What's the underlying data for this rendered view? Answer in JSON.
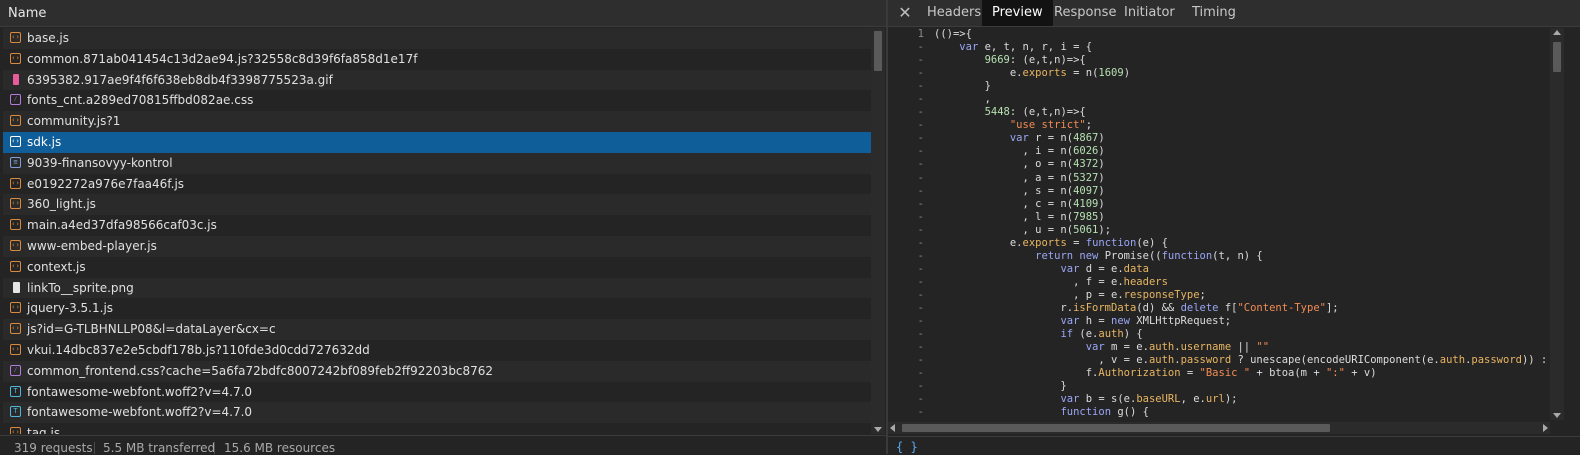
{
  "network_list": {
    "header": "Name",
    "rows": [
      {
        "name": "base.js",
        "icon": "script-icon",
        "type": "script"
      },
      {
        "name": "common.871ab041454c13d2ae94.js?32558c8d39f6fa858d1e17f",
        "icon": "script-icon",
        "type": "script"
      },
      {
        "name": "6395382.917ae9f4f6f638eb8db4f3398775523a.gif",
        "icon": "image-icon",
        "type": "gif"
      },
      {
        "name": "fonts_cnt.a289ed70815ffbd082ae.css",
        "icon": "stylesheet-icon",
        "type": "css"
      },
      {
        "name": "community.js?1",
        "icon": "script-icon",
        "type": "script"
      },
      {
        "name": "sdk.js",
        "icon": "script-icon",
        "type": "script",
        "selected": true
      },
      {
        "name": "9039-finansovyy-kontrol",
        "icon": "document-icon",
        "type": "doc"
      },
      {
        "name": "e0192272a976e7faa46f.js",
        "icon": "script-icon",
        "type": "script"
      },
      {
        "name": "360_light.js",
        "icon": "script-icon",
        "type": "script"
      },
      {
        "name": "main.a4ed37dfa98566caf03c.js",
        "icon": "script-icon",
        "type": "script"
      },
      {
        "name": "www-embed-player.js",
        "icon": "script-icon",
        "type": "script"
      },
      {
        "name": "context.js",
        "icon": "script-icon",
        "type": "script"
      },
      {
        "name": "linkTo__sprite.png",
        "icon": "image-icon",
        "type": "png"
      },
      {
        "name": "jquery-3.5.1.js",
        "icon": "script-icon",
        "type": "script"
      },
      {
        "name": "js?id=G-TLBHNLLP08&l=dataLayer&cx=c",
        "icon": "script-icon",
        "type": "script"
      },
      {
        "name": "vkui.14dbc837e2e5cbdf178b.js?110fde3d0cdd727632dd",
        "icon": "script-icon",
        "type": "script"
      },
      {
        "name": "common_frontend.css?cache=5a6fa72bdfc8007242bf089feb2ff92203bc8762",
        "icon": "stylesheet-icon",
        "type": "css"
      },
      {
        "name": "fontawesome-webfont.woff2?v=4.7.0",
        "icon": "font-icon",
        "type": "font"
      },
      {
        "name": "fontawesome-webfont.woff2?v=4.7.0",
        "icon": "font-icon",
        "type": "font"
      },
      {
        "name": "tag.js",
        "icon": "script-icon",
        "type": "script"
      }
    ]
  },
  "status": {
    "requests": "319 requests",
    "transferred": "5.5 MB transferred",
    "resources": "15.6 MB resources"
  },
  "detail_tabs": {
    "close_label": "✕",
    "tabs": [
      {
        "label": "Headers",
        "active": false
      },
      {
        "label": "Preview",
        "active": true
      },
      {
        "label": "Response",
        "active": false
      },
      {
        "label": "Initiator",
        "active": false
      },
      {
        "label": "Timing",
        "active": false
      }
    ]
  },
  "preview_code": {
    "lines": [
      {
        "n": "1",
        "html": "(()=>{"
      },
      {
        "n": "-",
        "html": "    <span class=\"kw\">var</span> e, t, n, r, i = {"
      },
      {
        "n": "-",
        "html": "        <span class=\"num\">9669</span>: (e,t,n)=>{"
      },
      {
        "n": "-",
        "html": "            e.<span class=\"prop\">exports</span> = n(<span class=\"num\">1609</span>)"
      },
      {
        "n": "-",
        "html": "        }"
      },
      {
        "n": "-",
        "html": "        ,"
      },
      {
        "n": "-",
        "html": "        <span class=\"num\">5448</span>: (e,t,n)=>{"
      },
      {
        "n": "-",
        "html": "            <span class=\"str\">\"use strict\"</span>;"
      },
      {
        "n": "-",
        "html": "            <span class=\"kw\">var</span> r = n(<span class=\"num\">4867</span>)"
      },
      {
        "n": "-",
        "html": "              , i = n(<span class=\"num\">6026</span>)"
      },
      {
        "n": "-",
        "html": "              , o = n(<span class=\"num\">4372</span>)"
      },
      {
        "n": "-",
        "html": "              , a = n(<span class=\"num\">5327</span>)"
      },
      {
        "n": "-",
        "html": "              , s = n(<span class=\"num\">4097</span>)"
      },
      {
        "n": "-",
        "html": "              , c = n(<span class=\"num\">4109</span>)"
      },
      {
        "n": "-",
        "html": "              , l = n(<span class=\"num\">7985</span>)"
      },
      {
        "n": "-",
        "html": "              , u = n(<span class=\"num\">5061</span>);"
      },
      {
        "n": "-",
        "html": "            e.<span class=\"prop\">exports</span> = <span class=\"kw\">function</span>(e) {"
      },
      {
        "n": "-",
        "html": "                <span class=\"kw\">return new</span> Promise((<span class=\"kw\">function</span>(t, n) {"
      },
      {
        "n": "-",
        "html": "                    <span class=\"kw\">var</span> d = e.<span class=\"prop\">data</span>"
      },
      {
        "n": "-",
        "html": "                      , f = e.<span class=\"prop\">headers</span>"
      },
      {
        "n": "-",
        "html": "                      , p = e.<span class=\"prop\">responseType</span>;"
      },
      {
        "n": "-",
        "html": "                    r.<span class=\"prop\">isFormData</span>(d) &amp;&amp; <span class=\"kw\">delete</span> f[<span class=\"str\">\"Content-Type\"</span>];"
      },
      {
        "n": "-",
        "html": "                    <span class=\"kw\">var</span> h = <span class=\"kw\">new</span> XMLHttpRequest;"
      },
      {
        "n": "-",
        "html": "                    <span class=\"kw\">if</span> (e.<span class=\"prop\">auth</span>) {"
      },
      {
        "n": "-",
        "html": "                        <span class=\"kw\">var</span> m = e.<span class=\"prop\">auth</span>.<span class=\"prop\">username</span> || <span class=\"str\">\"\"</span>"
      },
      {
        "n": "-",
        "html": "                          , v = e.<span class=\"prop\">auth</span>.<span class=\"prop\">password</span> ? unescape(encodeURIComponent(e.<span class=\"prop\">auth</span>.<span class=\"prop\">password</span>)) : <span class=\"str\">\"\"</span>;"
      },
      {
        "n": "-",
        "html": "                        f.<span class=\"prop\">Authorization</span> = <span class=\"str\">\"Basic \"</span> + btoa(m + <span class=\"str\">\":\"</span> + v)"
      },
      {
        "n": "-",
        "html": "                    }"
      },
      {
        "n": "-",
        "html": "                    <span class=\"kw\">var</span> b = s(e.<span class=\"prop\">baseURL</span>, e.<span class=\"prop\">url</span>);"
      },
      {
        "n": "-",
        "html": "                    <span class=\"kw\">function</span> g() {"
      }
    ]
  },
  "bottom_bar": {
    "pretty_print": "{ }"
  }
}
